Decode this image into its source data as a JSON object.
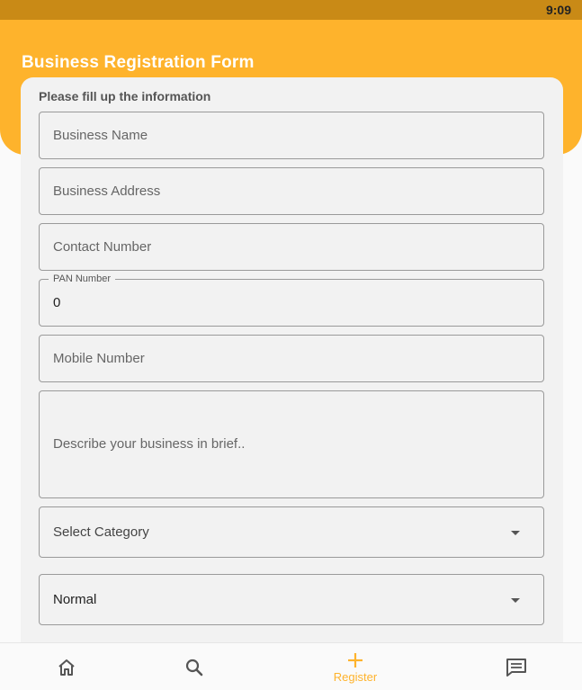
{
  "status_bar": {
    "time": "9:09"
  },
  "app_bar": {
    "title": "Business Registration Form"
  },
  "form": {
    "heading": "Please fill up the information",
    "business_name": {
      "placeholder": "Business Name"
    },
    "business_address": {
      "placeholder": "Business Address"
    },
    "contact_number": {
      "placeholder": "Contact Number"
    },
    "pan_number": {
      "label": "PAN Number",
      "value": "0"
    },
    "mobile_number": {
      "placeholder": "Mobile Number"
    },
    "description": {
      "placeholder": "Describe your business in brief.."
    },
    "category_select": {
      "value": "Select Category"
    },
    "type_select": {
      "value": "Normal"
    }
  },
  "bottom_nav": {
    "items": [
      {
        "icon": "home-icon"
      },
      {
        "icon": "search-icon"
      },
      {
        "icon": "plus-icon",
        "label": "Register"
      },
      {
        "icon": "message-icon"
      }
    ]
  },
  "colors": {
    "accent": "#feb32c",
    "status_bar": "#c98a16",
    "card": "#f2f2f2"
  }
}
